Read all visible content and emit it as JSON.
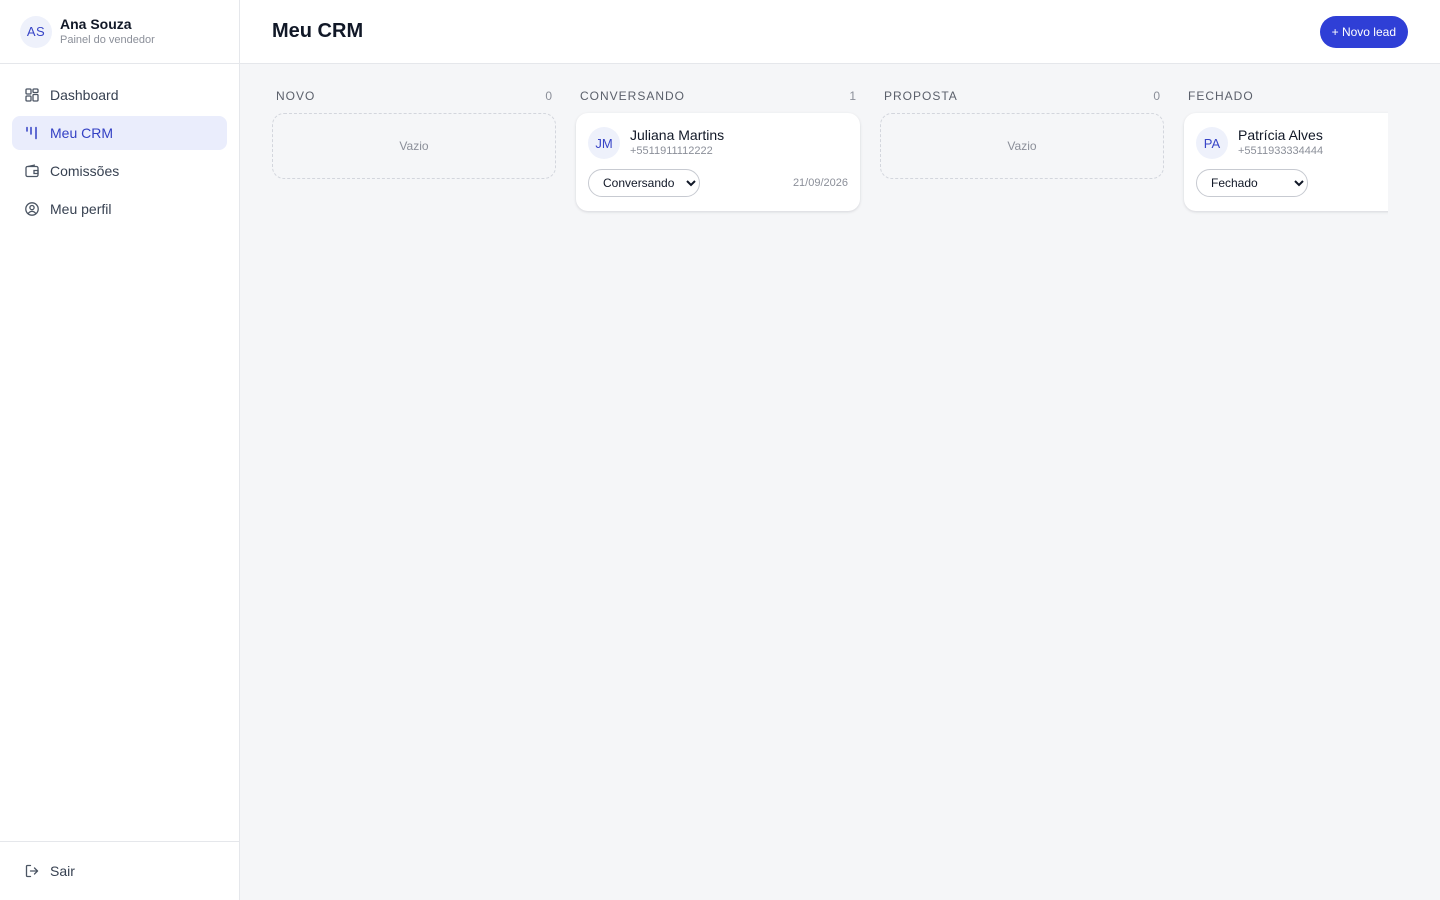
{
  "user": {
    "initials": "AS",
    "name": "Ana Souza",
    "role": "Painel do vendedor"
  },
  "nav": [
    {
      "label": "Dashboard",
      "icon": "dashboard-grid-icon",
      "active": false
    },
    {
      "label": "Meu CRM",
      "icon": "kanban-icon",
      "active": true
    },
    {
      "label": "Comissões",
      "icon": "wallet-icon",
      "active": false
    },
    {
      "label": "Meu perfil",
      "icon": "user-circle-icon",
      "active": false
    }
  ],
  "footer": {
    "logout_label": "Sair",
    "icon": "logout-icon"
  },
  "header": {
    "title": "Meu CRM",
    "new_lead_label": "+ Novo lead"
  },
  "colors": {
    "primary": "#2f3fd6",
    "active_nav_bg": "#eaedfc",
    "active_nav_text": "#3340c4"
  },
  "columns": [
    {
      "title": "NOVO",
      "count": "0",
      "empty_label": "Vazio",
      "cards": []
    },
    {
      "title": "CONVERSANDO",
      "count": "1",
      "cards": [
        {
          "initials": "JM",
          "name": "Juliana Martins",
          "phone": "+5511911112222",
          "status": "Conversando",
          "date": "21/09/2026"
        }
      ]
    },
    {
      "title": "PROPOSTA",
      "count": "0",
      "empty_label": "Vazio",
      "cards": []
    },
    {
      "title": "FECHADO",
      "count": "",
      "cards": [
        {
          "initials": "PA",
          "name": "Patrícia Alves",
          "phone": "+5511933334444",
          "status": "Fechado",
          "date": ""
        }
      ]
    }
  ]
}
